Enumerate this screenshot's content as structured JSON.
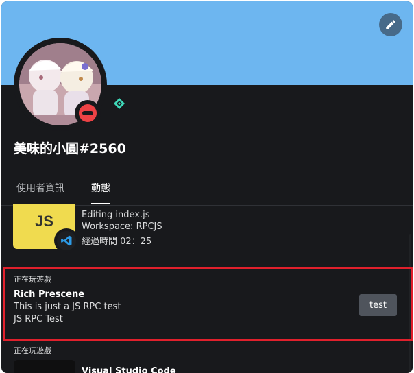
{
  "profile": {
    "username": "美味的小圓#2560",
    "status": "dnd",
    "banner_color": "#6db6f0"
  },
  "tabs": [
    {
      "label": "使用者資訊",
      "active": false
    },
    {
      "label": "動態",
      "active": true
    }
  ],
  "activities": [
    {
      "large_image": "js-icon",
      "large_image_text": "JS",
      "small_image": "vscode-icon",
      "details": "Editing index.js",
      "state": "Workspace: RPCJS",
      "elapsed": "經過時間 02：25"
    },
    {
      "header": "正在玩遊戲",
      "name": "Rich Prescene",
      "details": "This is just a JS RPC test",
      "state": "JS RPC Test",
      "button_label": "test"
    },
    {
      "header": "正在玩遊戲",
      "name": "Visual Studio Code"
    }
  ]
}
